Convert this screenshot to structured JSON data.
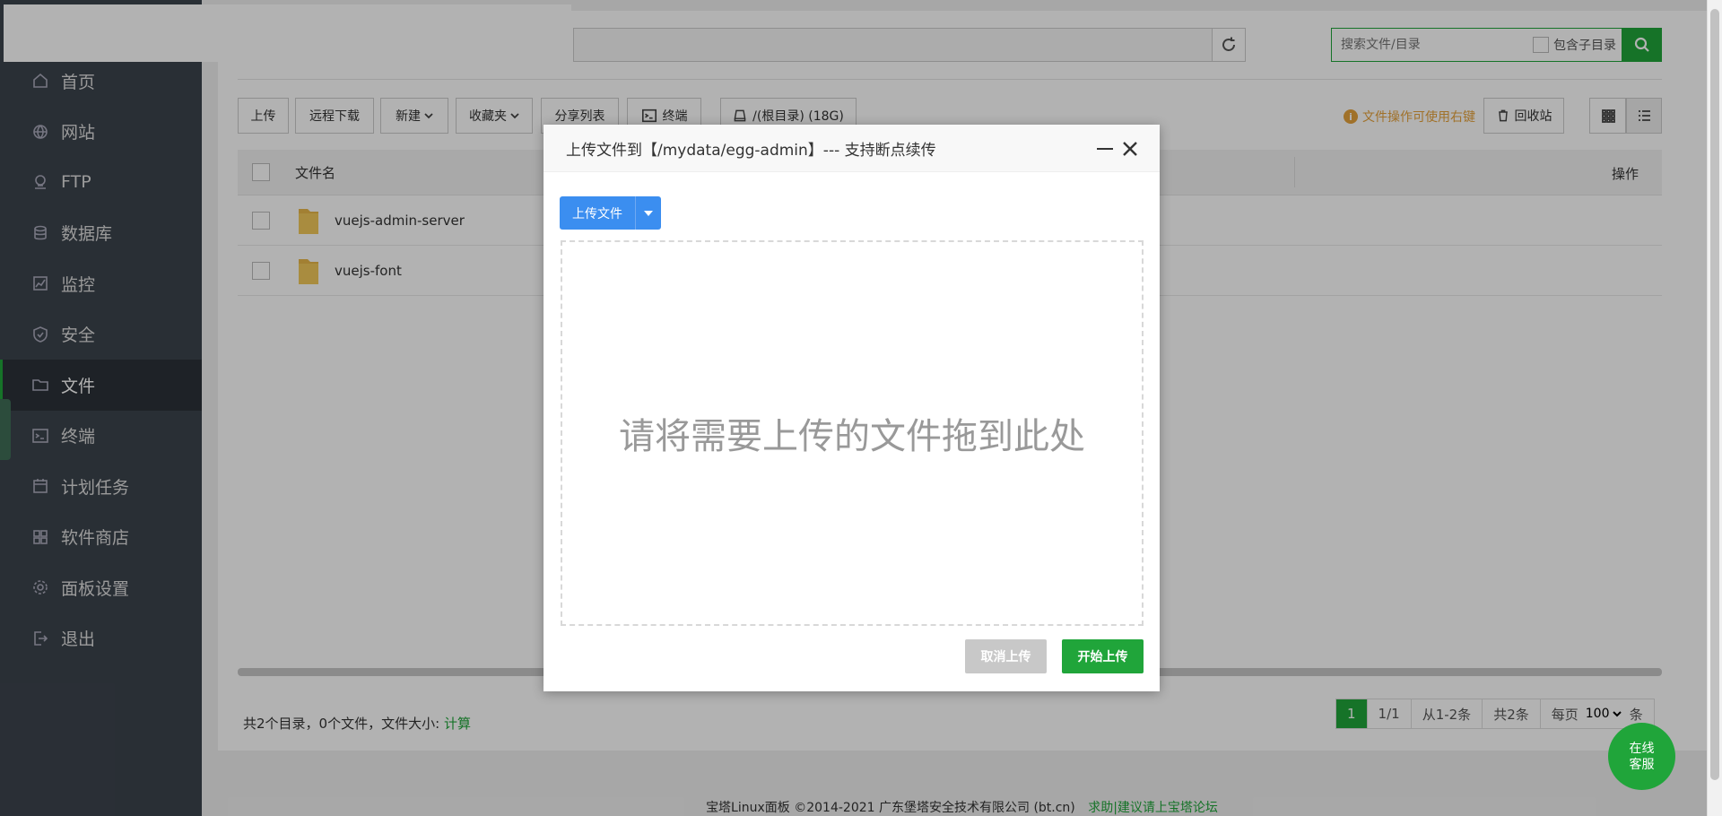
{
  "sidebar": {
    "items": [
      {
        "label": "首页",
        "icon": "home-icon"
      },
      {
        "label": "网站",
        "icon": "globe-icon"
      },
      {
        "label": "FTP",
        "icon": "ftp-icon"
      },
      {
        "label": "数据库",
        "icon": "database-icon"
      },
      {
        "label": "监控",
        "icon": "monitor-icon"
      },
      {
        "label": "安全",
        "icon": "shield-icon"
      },
      {
        "label": "文件",
        "icon": "folder-icon",
        "active": true
      },
      {
        "label": "终端",
        "icon": "terminal-icon"
      },
      {
        "label": "计划任务",
        "icon": "calendar-icon"
      },
      {
        "label": "软件商店",
        "icon": "apps-icon"
      },
      {
        "label": "面板设置",
        "icon": "gear-icon"
      },
      {
        "label": "退出",
        "icon": "logout-icon"
      }
    ]
  },
  "search": {
    "placeholder": "搜索文件/目录",
    "include_subdir_label": "包含子目录"
  },
  "toolbar": {
    "upload": "上传",
    "remote_download": "远程下载",
    "new": "新建",
    "favorites": "收藏夹",
    "share_list": "分享列表",
    "terminal": "终端",
    "disk": "/(根目录) (18G)",
    "tip": "文件操作可使用右键",
    "recycle": "回收站"
  },
  "table": {
    "col_name": "文件名",
    "col_actions": "操作",
    "rows": [
      {
        "name": "vuejs-admin-server"
      },
      {
        "name": "vuejs-font"
      }
    ]
  },
  "footer": {
    "summary": "共2个目录，0个文件，文件大小:",
    "calc_link": "计算",
    "pager": {
      "current": "1",
      "pages": "1/1",
      "range": "从1-2条",
      "total": "共2条",
      "per_page_label": "每页",
      "per_page_value": "100",
      "unit": "条"
    }
  },
  "copyright": {
    "text": "宝塔Linux面板 ©2014-2021 广东堡塔安全技术有限公司 (bt.cn)",
    "link": "求助|建议请上宝塔论坛"
  },
  "online_service": {
    "line1": "在线",
    "line2": "客服"
  },
  "modal": {
    "title": "上传文件到【/mydata/egg-admin】--- 支持断点续传",
    "upload_button": "上传文件",
    "dropzone_text": "请将需要上传的文件拖到此处",
    "cancel_button": "取消上传",
    "start_button": "开始上传"
  },
  "colors": {
    "accent": "#20a53a",
    "sidebar_bg": "#3c444d",
    "upload_blue": "#3b8ef0",
    "tip_orange": "#e6a23c"
  }
}
